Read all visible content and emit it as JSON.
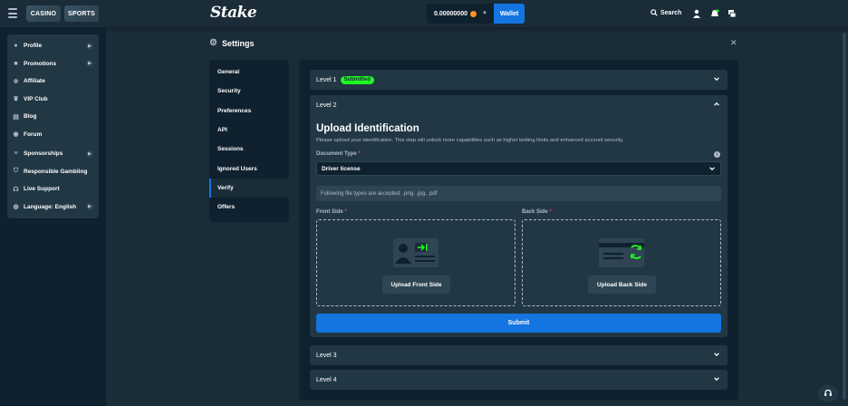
{
  "topbar": {
    "casino_label": "CASINO",
    "sports_label": "SPORTS",
    "logo": "Stake",
    "balance": "0.00000000",
    "wallet_label": "Wallet",
    "search_label": "Search"
  },
  "sidebar": {
    "group1": [
      {
        "label": "Profile",
        "icon": "user-icon",
        "has_arrow": true
      },
      {
        "label": "Promotions",
        "icon": "gift-icon",
        "has_arrow": true
      },
      {
        "label": "Affiliate",
        "icon": "affiliate-icon",
        "has_arrow": false
      },
      {
        "label": "VIP Club",
        "icon": "trophy-icon",
        "has_arrow": false
      },
      {
        "label": "Blog",
        "icon": "blog-icon",
        "has_arrow": false
      },
      {
        "label": "Forum",
        "icon": "forum-icon",
        "has_arrow": false
      }
    ],
    "group2": [
      {
        "label": "Sponsorships",
        "icon": "sponsorship-icon",
        "has_arrow": true
      },
      {
        "label": "Responsible Gambling",
        "icon": "shield-icon",
        "has_arrow": false
      },
      {
        "label": "Live Support",
        "icon": "headset-icon",
        "has_arrow": false
      },
      {
        "label": "Language: English",
        "icon": "globe-icon",
        "has_arrow": true
      }
    ]
  },
  "settings": {
    "title": "Settings",
    "menu": [
      "General",
      "Security",
      "Preferences",
      "API",
      "Sessions",
      "Ignored Users",
      "Verify",
      "Offers"
    ],
    "active_menu": "Verify"
  },
  "verify": {
    "level1_label": "Level 1",
    "level1_badge": "Submitted",
    "level2_label": "Level 2",
    "level3_label": "Level 3",
    "level4_label": "Level 4",
    "upload_title": "Upload Identification",
    "upload_desc": "Please upload your identification. This step will unlock more capabilities such as higher betting limits and enhanced account security.",
    "doc_type_label": "Document Type",
    "doc_type_value": "Driver license",
    "file_note": "Following file types are accepted: .png, .jpg, .pdf",
    "front_label": "Front Side",
    "back_label": "Back Side",
    "front_button": "Upload Front Side",
    "back_button": "Upload Back Side",
    "submit_label": "Submit",
    "required_mark": "*"
  },
  "colors": {
    "background": "#1a2c38",
    "sidebar": "#0f212e",
    "card": "#213743",
    "accent_blue": "#1475e1",
    "badge_green": "#1fff20"
  }
}
